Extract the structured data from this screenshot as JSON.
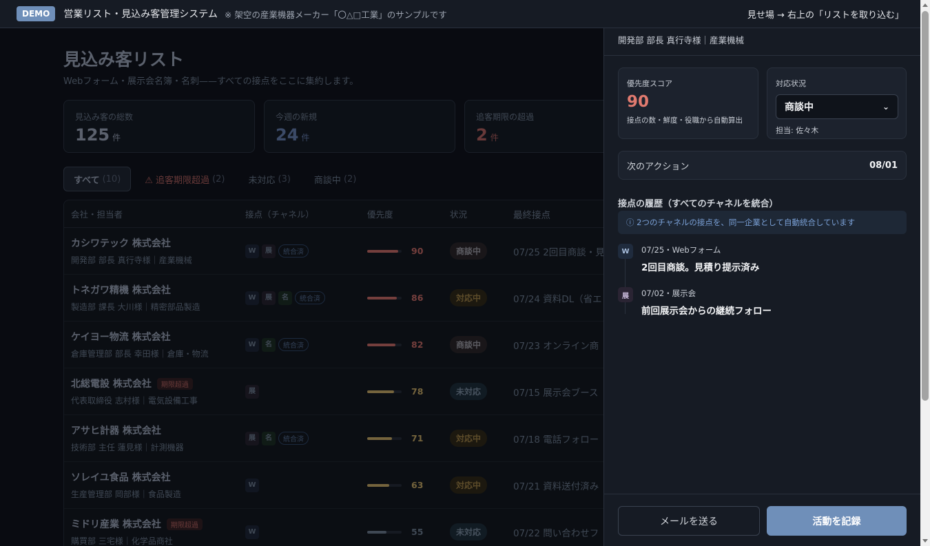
{
  "topbar": {
    "badge": "DEMO",
    "title": "営業リスト・見込み客管理システム",
    "note": "※ 架空の産業機器メーカー「〇△□工業」のサンプルです",
    "right_text": "見せ場 → 右上の「リストを取り込む」"
  },
  "page": {
    "title": "見込み客リスト",
    "subtitle": "Webフォーム・展示会名簿・名刺——すべての接点をここに集約します。"
  },
  "stats": [
    {
      "label": "見込み客の総数",
      "value": "125",
      "unit": "件"
    },
    {
      "label": "今週の新規",
      "value": "24",
      "unit": "件"
    },
    {
      "label": "追客期限の超過",
      "value": "2",
      "unit": "件"
    }
  ],
  "tabs": [
    {
      "label": "すべて",
      "count": "(10)"
    },
    {
      "label": "⚠ 追客期限超過",
      "count": "(2)"
    },
    {
      "label": "未対応",
      "count": "(3)"
    },
    {
      "label": "商談中",
      "count": "(2)"
    }
  ],
  "table": {
    "headers": [
      "会社・担当者",
      "接点（チャネル）",
      "優先度",
      "状況",
      "最終接点"
    ],
    "merged_label": "統合済",
    "overdue_label": "期限超過",
    "rows": [
      {
        "company": "カシワテック 株式会社",
        "sub": "開発部 部長 真行寺様｜産業機械",
        "channels": [
          "W",
          "展"
        ],
        "merged": true,
        "overdue": false,
        "score": 90,
        "status": "商談中",
        "last": "07/25 2回目商談・見"
      },
      {
        "company": "トネガワ精機 株式会社",
        "sub": "製造部 課長 大川様｜精密部品製造",
        "channels": [
          "W",
          "展",
          "名"
        ],
        "merged": true,
        "overdue": false,
        "score": 86,
        "status": "対応中",
        "last": "07/24 資料DL（省エ"
      },
      {
        "company": "ケイヨー物流 株式会社",
        "sub": "倉庫管理部 部長 幸田様｜倉庫・物流",
        "channels": [
          "W",
          "名"
        ],
        "merged": true,
        "overdue": false,
        "score": 82,
        "status": "商談中",
        "last": "07/23 オンライン商"
      },
      {
        "company": "北総電設 株式会社",
        "sub": "代表取締役 志村様｜電気設備工事",
        "channels": [
          "展"
        ],
        "merged": false,
        "overdue": true,
        "score": 78,
        "status": "未対応",
        "last": "07/15 展示会ブース"
      },
      {
        "company": "アサヒ計器 株式会社",
        "sub": "技術部 主任 蓮見様｜計測機器",
        "channels": [
          "展",
          "名"
        ],
        "merged": true,
        "overdue": false,
        "score": 71,
        "status": "対応中",
        "last": "07/18 電話フォロー"
      },
      {
        "company": "ソレイユ食品 株式会社",
        "sub": "生産管理部 岡部様｜食品製造",
        "channels": [
          "W"
        ],
        "merged": false,
        "overdue": false,
        "score": 63,
        "status": "対応中",
        "last": "07/21 資料送付済み"
      },
      {
        "company": "ミドリ産業 株式会社",
        "sub": "購買部 三宅様｜化学品商社",
        "channels": [
          "W"
        ],
        "merged": false,
        "overdue": true,
        "score": 55,
        "status": "未対応",
        "last": "07/22 問い合わせフ"
      }
    ]
  },
  "panel": {
    "header_sub": "開発部 部長 真行寺様｜産業機械",
    "score_label": "優先度スコア",
    "score_value": "90",
    "score_note": "接点の数・鮮度・役職から自動算出",
    "status_label": "対応状況",
    "status_value": "商談中",
    "owner": "担当: 佐々木",
    "next_action_label": "次のアクション",
    "next_action_date": "08/01",
    "history_title": "接点の履歴（すべてのチャネルを統合）",
    "merge_note": "ⓘ 2つのチャネルの接点を、同一企業として自動統合しています",
    "history": [
      {
        "icon": "W",
        "meta": "07/25・Webフォーム",
        "text": "2回目商談。見積り提示済み"
      },
      {
        "icon": "展",
        "meta": "07/02・展示会",
        "text": "前回展示会からの継続フォロー"
      }
    ],
    "btn_mail": "メールを送る",
    "btn_log": "活動を記録"
  },
  "colors": {
    "accent": "#6f8fb9",
    "score_red": "#e07a6f",
    "bar_high": "#8a4a48",
    "bar_mid": "#8a7648",
    "bar_low": "#4b5563"
  }
}
